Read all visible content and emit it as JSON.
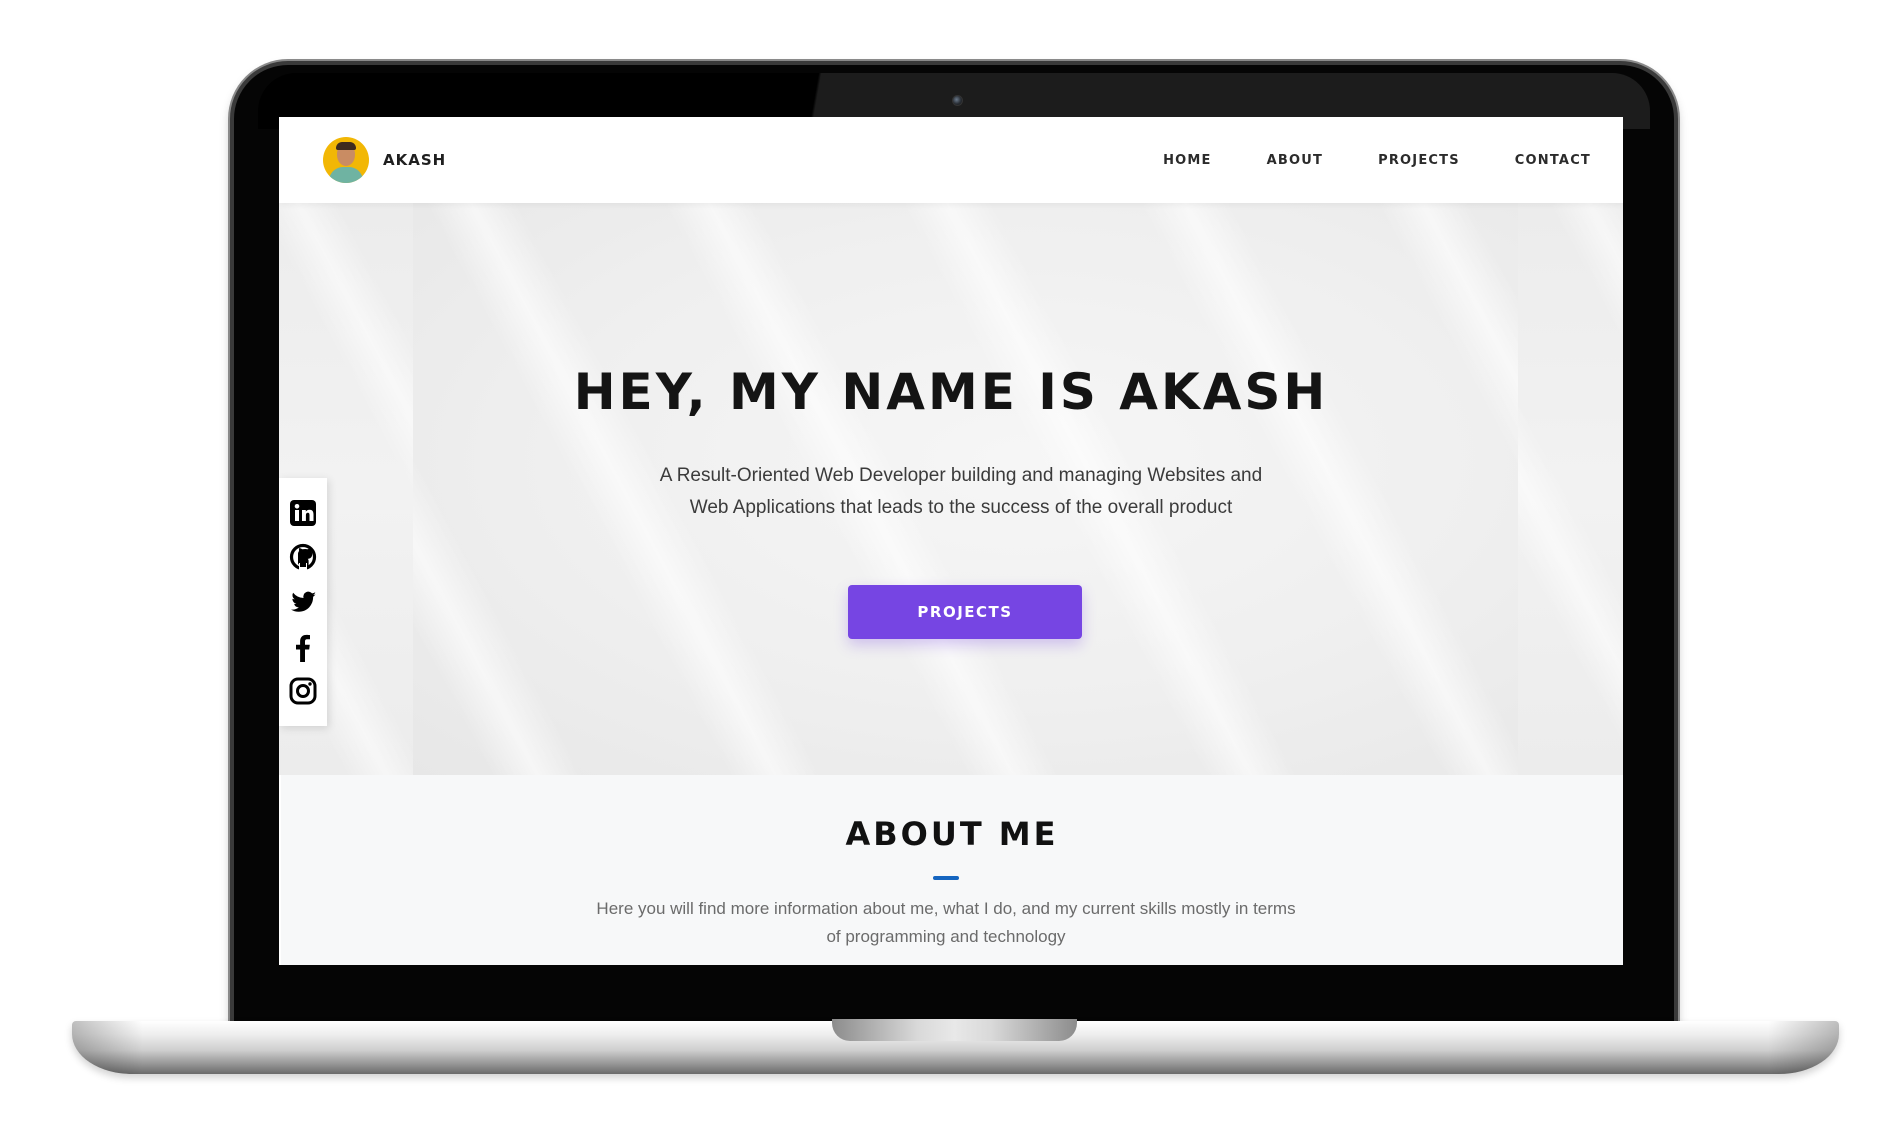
{
  "header": {
    "brand_name": "AKASH",
    "nav": [
      {
        "label": "HOME"
      },
      {
        "label": "ABOUT"
      },
      {
        "label": "PROJECTS"
      },
      {
        "label": "CONTACT"
      }
    ]
  },
  "hero": {
    "title": "HEY, MY NAME IS AKASH",
    "subtitle": "A Result-Oriented Web Developer building and managing Websites and Web Applications that leads to the success of the overall product",
    "button_label": "PROJECTS"
  },
  "social": {
    "icons": [
      "linkedin-icon",
      "github-icon",
      "twitter-icon",
      "facebook-icon",
      "instagram-icon"
    ]
  },
  "about": {
    "title": "ABOUT ME",
    "text": "Here you will find more information about me, what I do, and my current skills mostly in terms of programming and technology"
  },
  "colors": {
    "accent": "#7645e3",
    "underline": "#1565c0",
    "avatar_bg": "#f2b705"
  }
}
